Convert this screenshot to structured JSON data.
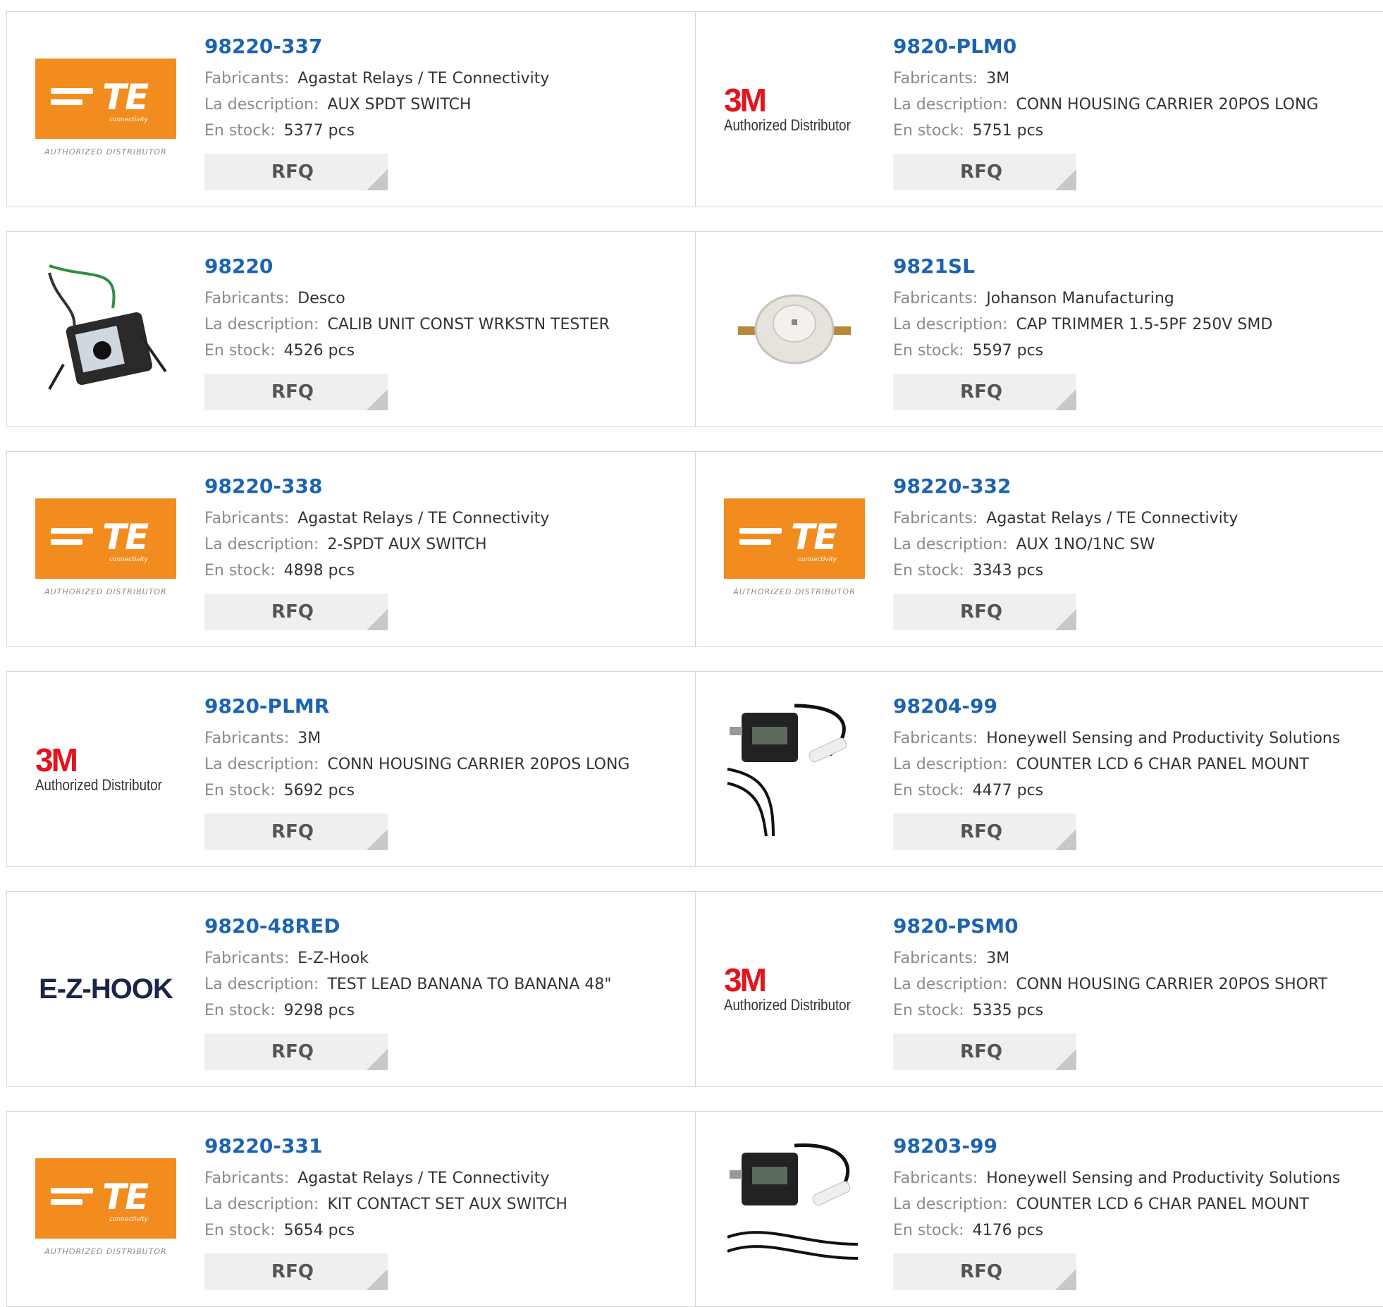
{
  "labels": {
    "manufacturer": "Fabricants:",
    "description": "La description:",
    "stock": "En stock:",
    "rfq": "RFQ"
  },
  "logo_text": {
    "te_brand": "TE",
    "te_sub": "connectivity",
    "te_authorized": "AUTHORIZED DISTRIBUTOR",
    "m3_brand": "3M",
    "m3_authorized": "Authorized Distributor",
    "ez_brand": "E-Z-HOOK"
  },
  "products": [
    {
      "part": "98220-337",
      "manufacturer": "Agastat Relays / TE Connectivity",
      "description": "AUX SPDT SWITCH",
      "stock": "5377 pcs",
      "logo": "te"
    },
    {
      "part": "9820-PLM0",
      "manufacturer": "3M",
      "description": "CONN HOUSING CARRIER 20POS LONG",
      "stock": "5751 pcs",
      "logo": "3m"
    },
    {
      "part": "98220",
      "manufacturer": "Desco",
      "description": "CALIB UNIT CONST WRKSTN TESTER",
      "stock": "4526 pcs",
      "logo": "tester-photo"
    },
    {
      "part": "9821SL",
      "manufacturer": "Johanson Manufacturing",
      "description": "CAP TRIMMER 1.5-5PF 250V SMD",
      "stock": "5597 pcs",
      "logo": "trimmer-photo"
    },
    {
      "part": "98220-338",
      "manufacturer": "Agastat Relays / TE Connectivity",
      "description": "2-SPDT AUX SWITCH",
      "stock": "4898 pcs",
      "logo": "te"
    },
    {
      "part": "98220-332",
      "manufacturer": "Agastat Relays / TE Connectivity",
      "description": "AUX 1NO/1NC SW",
      "stock": "3343 pcs",
      "logo": "te"
    },
    {
      "part": "9820-PLMR",
      "manufacturer": "3M",
      "description": "CONN HOUSING CARRIER 20POS LONG",
      "stock": "5692 pcs",
      "logo": "3m"
    },
    {
      "part": "98204-99",
      "manufacturer": "Honeywell Sensing and Productivity Solutions",
      "description": "COUNTER LCD 6 CHAR PANEL MOUNT",
      "stock": "4477 pcs",
      "logo": "counter-photo"
    },
    {
      "part": "9820-48RED",
      "manufacturer": "E-Z-Hook",
      "description": "TEST LEAD BANANA TO BANANA 48\"",
      "stock": "9298 pcs",
      "logo": "ezhook"
    },
    {
      "part": "9820-PSM0",
      "manufacturer": "3M",
      "description": "CONN HOUSING CARRIER 20POS SHORT",
      "stock": "5335 pcs",
      "logo": "3m"
    },
    {
      "part": "98220-331",
      "manufacturer": "Agastat Relays / TE Connectivity",
      "description": "KIT CONTACT SET AUX SWITCH",
      "stock": "5654 pcs",
      "logo": "te"
    },
    {
      "part": "98203-99",
      "manufacturer": "Honeywell Sensing and Productivity Solutions",
      "description": "COUNTER LCD 6 CHAR PANEL MOUNT",
      "stock": "4176 pcs",
      "logo": "counter-photo"
    }
  ],
  "colors": {
    "part_link": "#1c64b0",
    "te_orange": "#f28c1e",
    "m3_red": "#e3141d",
    "rfq_bg": "#efefef"
  }
}
